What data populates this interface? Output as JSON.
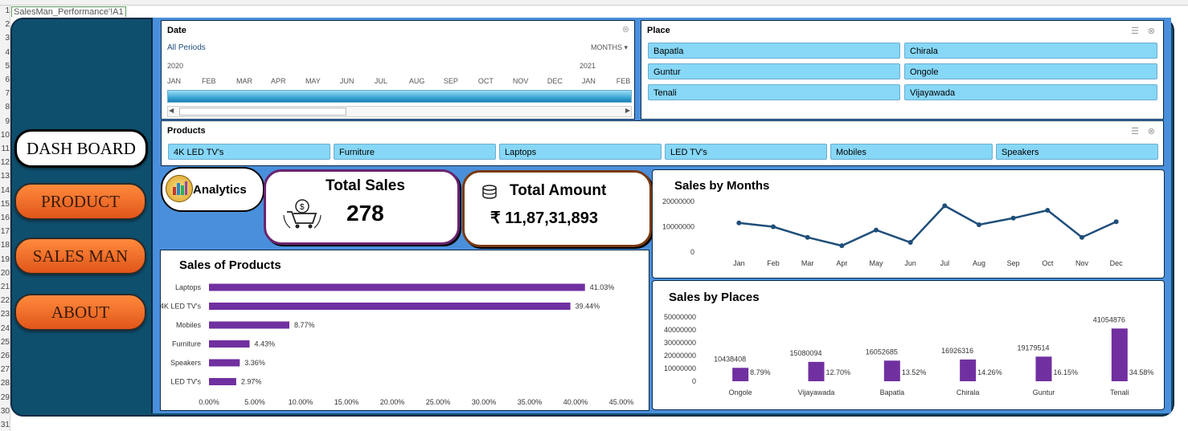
{
  "sheet": {
    "name_box": "SalesMan_Performance'!A1",
    "row_numbers": [
      "1",
      "2",
      "3",
      "4",
      "5",
      "6",
      "7",
      "8",
      "9",
      "10",
      "11",
      "12",
      "13",
      "14",
      "15",
      "16",
      "17",
      "18",
      "19",
      "20",
      "21",
      "22",
      "23",
      "24",
      "25",
      "26",
      "27",
      "28",
      "29",
      "30",
      "31"
    ]
  },
  "nav": {
    "dashboard": "DASH BOARD",
    "product": "PRODUCT",
    "salesman": "SALES MAN",
    "about": "ABOUT"
  },
  "date_filter": {
    "title": "Date",
    "period": "All Periods",
    "granularity": "MONTHS",
    "years": [
      "2020",
      "2021"
    ],
    "months": [
      "JAN",
      "FEB",
      "MAR",
      "APR",
      "MAY",
      "JUN",
      "JUL",
      "AUG",
      "SEP",
      "OCT",
      "NOV",
      "DEC",
      "JAN",
      "FEB"
    ]
  },
  "place_filter": {
    "title": "Place",
    "items": [
      "Bapatla",
      "Chirala",
      "Guntur",
      "Ongole",
      "Tenali",
      "Vijayawada"
    ]
  },
  "product_filter": {
    "title": "Products",
    "items": [
      "4K LED TV's",
      "Furniture",
      "Laptops",
      "LED TV's",
      "Mobiles",
      "Speakers"
    ]
  },
  "analytics_label": "Analytics",
  "total_sales": {
    "label": "Total Sales",
    "value": "278"
  },
  "total_amount": {
    "label": "Total Amount",
    "value": "₹ 11,87,31,893"
  },
  "colors": {
    "nav_orange": "#f26b22",
    "bar_purple": "#7030a0",
    "line_blue": "#1f4e79",
    "slicer_blue": "#87d7f7",
    "dashboard_blue": "#4a8fdb",
    "sidebar": "#0f4f6e"
  },
  "chart_data": [
    {
      "type": "line",
      "title": "Sales by Months",
      "categories": [
        "Jan",
        "Feb",
        "Mar",
        "Apr",
        "May",
        "Jun",
        "Jul",
        "Aug",
        "Sep",
        "Oct",
        "Nov",
        "Dec"
      ],
      "values": [
        11500000,
        10000000,
        5800000,
        2500000,
        8700000,
        3800000,
        18300000,
        10800000,
        13400000,
        16500000,
        5800000,
        12000000
      ],
      "yticks": [
        "0",
        "10000000",
        "20000000"
      ],
      "ylim": [
        0,
        20000000
      ]
    },
    {
      "type": "bar",
      "title": "Sales of Products",
      "categories": [
        "Laptops",
        "4K LED TV's",
        "Mobiles",
        "Furniture",
        "Speakers",
        "LED TV's"
      ],
      "values": [
        41.03,
        39.44,
        8.77,
        4.43,
        3.36,
        2.97
      ],
      "labels": [
        "41.03%",
        "39.44%",
        "8.77%",
        "4.43%",
        "3.36%",
        "2.97%"
      ],
      "xticks": [
        "0.00%",
        "5.00%",
        "10.00%",
        "15.00%",
        "20.00%",
        "25.00%",
        "30.00%",
        "35.00%",
        "40.00%",
        "45.00%"
      ],
      "xlim": [
        0,
        45
      ]
    },
    {
      "type": "bar",
      "title": "Sales by Places",
      "categories": [
        "Ongole",
        "Vijayawada",
        "Bapatla",
        "Chirala",
        "Guntur",
        "Tenali"
      ],
      "values": [
        10438408,
        15080094,
        16052685,
        16926316,
        19179514,
        41054876
      ],
      "value_labels": [
        "10438408",
        "15080094",
        "16052685",
        "16926316",
        "19179514",
        "41054876"
      ],
      "percent_labels": [
        "8.79%",
        "12.70%",
        "13.52%",
        "14.26%",
        "16.15%",
        "34.58%"
      ],
      "yticks": [
        "0",
        "10000000",
        "20000000",
        "30000000",
        "40000000",
        "50000000"
      ],
      "ylim": [
        0,
        50000000
      ]
    }
  ]
}
